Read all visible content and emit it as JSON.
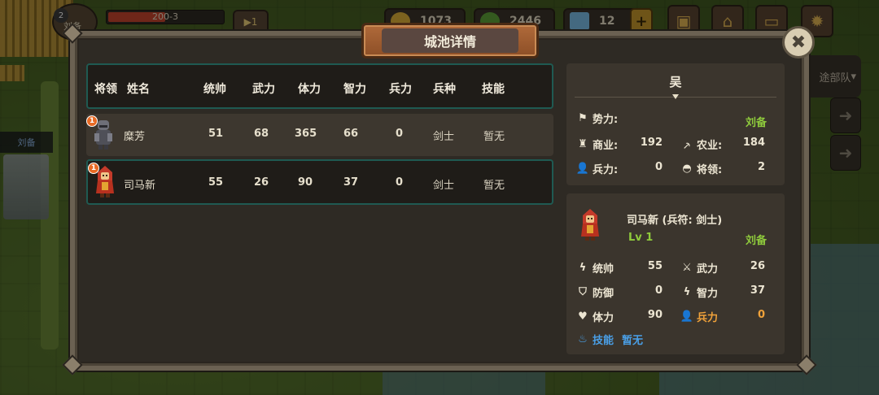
{
  "hud": {
    "player_level": "2",
    "player_name": "刘备",
    "hp_text": "200-3",
    "arrow_btn": "▶1",
    "gold": "1073",
    "food": "2446",
    "diamond": "12",
    "plus": "+",
    "dropdown_label": "途部队"
  },
  "map": {
    "castle_label": "刘备"
  },
  "dialog": {
    "title": "城池详情",
    "close_label": "✖"
  },
  "table": {
    "headers": [
      "将领",
      "姓名",
      "统帅",
      "武力",
      "体力",
      "智力",
      "兵力",
      "兵种",
      "技能"
    ],
    "rows": [
      {
        "badge": "1",
        "portrait": "dark-armored-general",
        "name": "糜芳",
        "command": "51",
        "force": "68",
        "vitality": "365",
        "intellect": "66",
        "troops": "0",
        "unit": "剑士",
        "skill": "暂无",
        "selected": false
      },
      {
        "badge": "1",
        "portrait": "red-hooded-general",
        "name": "司马新",
        "command": "55",
        "force": "26",
        "vitality": "90",
        "intellect": "37",
        "troops": "0",
        "unit": "剑士",
        "skill": "暂无",
        "selected": true
      }
    ]
  },
  "city": {
    "faction": "吴",
    "power_label": "势力:",
    "power_value": "刘备",
    "commerce_label": "商业:",
    "commerce_value": "192",
    "agriculture_label": "农业:",
    "agriculture_value": "184",
    "troops_label": "兵力:",
    "troops_value": "0",
    "generals_label": "将领:",
    "generals_value": "2"
  },
  "general": {
    "title": "司马新 (兵符: 剑士)",
    "level": "Lv 1",
    "lord": "刘备",
    "stats": {
      "command_label": "统帅",
      "command_value": "55",
      "force_label": "武力",
      "force_value": "26",
      "defense_label": "防御",
      "defense_value": "0",
      "intellect_label": "智力",
      "intellect_value": "37",
      "vitality_label": "体力",
      "vitality_value": "90",
      "troops_label": "兵力",
      "troops_value": "0"
    },
    "skill_label": "技能",
    "skill_value": "暂无"
  },
  "colors": {
    "accent_teal": "#1f5a52",
    "green": "#8fcb3c",
    "orange": "#f0a23a",
    "blue": "#4aa0e8"
  }
}
